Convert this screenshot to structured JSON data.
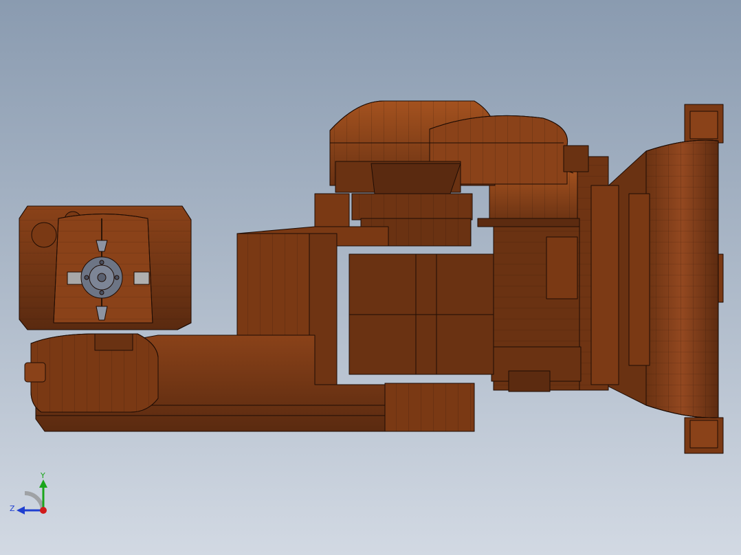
{
  "viewport": {
    "background_top": "#8a9bb0",
    "background_bottom": "#d2d9e3"
  },
  "model": {
    "description_icon": "robot-arm-3d-model",
    "shade_dark": "#5a2a10",
    "shade_mid": "#7a3914",
    "shade_light": "#96491c",
    "edge_color": "#1e0c04",
    "flange_color": "#6d7585"
  },
  "triad": {
    "x_label": "",
    "y_label": "Y",
    "z_label": "Z",
    "y_color": "#1aa51a",
    "z_color": "#1f3fd0",
    "x_color": "#d01a1a"
  }
}
